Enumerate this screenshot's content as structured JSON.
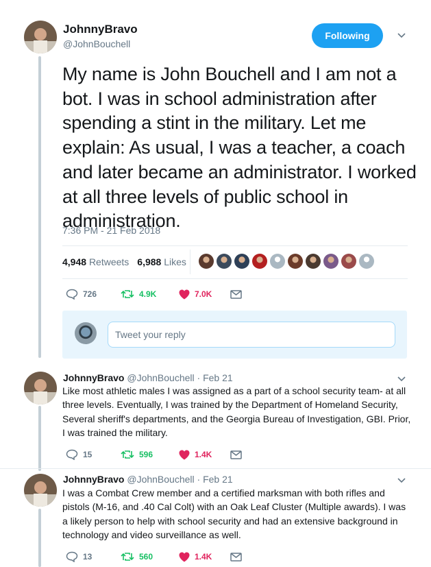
{
  "main_tweet": {
    "display_name": "JohnnyBravo",
    "handle": "@JohnBouchell",
    "follow_label": "Following",
    "text": "My name is John Bouchell and I am not a bot. I was in school administration after spending a stint in the military.  Let me explain: As usual, I was a teacher, a coach and later became an administrator. I worked at all three levels of public school in administration.",
    "timestamp": "7:36 PM - 21 Feb 2018",
    "retweets_count": "4,948",
    "retweets_label": "Retweets",
    "likes_count": "6,988",
    "likes_label": "Likes",
    "actions": {
      "replies": "726",
      "retweets": "4.9K",
      "likes": "7.0K"
    }
  },
  "likers": [
    {
      "icon": "liker-avatar",
      "color": "#5a3a2e"
    },
    {
      "icon": "liker-avatar",
      "color": "#3b4a5c"
    },
    {
      "icon": "liker-avatar",
      "color": "#2e4057"
    },
    {
      "icon": "liker-avatar",
      "color": "#b32020"
    },
    {
      "icon": "default-avatar",
      "color": "#aab8c2"
    },
    {
      "icon": "liker-avatar",
      "color": "#6b3b2a"
    },
    {
      "icon": "liker-avatar",
      "color": "#4a3a30"
    },
    {
      "icon": "liker-avatar",
      "color": "#7a5a8a"
    },
    {
      "icon": "liker-avatar",
      "color": "#9a4a4a"
    },
    {
      "icon": "default-avatar",
      "color": "#aab8c2"
    }
  ],
  "reply_box": {
    "placeholder": "Tweet your reply"
  },
  "replies": [
    {
      "display_name": "JohnnyBravo",
      "meta": "@JohnBouchell · Feb 21",
      "text": "Like most athletic males I was assigned as a part of a school security team- at all three levels. Eventually, I was trained by the Department of Homeland Security, Several sheriff's departments, and the Georgia Bureau of Investigation, GBI. Prior, I was trained the military.",
      "replies": "15",
      "retweets": "596",
      "likes": "1.4K"
    },
    {
      "display_name": "JohnnyBravo",
      "meta": "@JohnBouchell · Feb 21",
      "text": "I was a Combat Crew member and a certified marksman with both rifles and pistols (M-16, and .40 Cal Colt) with an Oak Leaf Cluster (Multiple awards). I was a likely person to help with school security and had an extensive background in technology and video surveillance as well.",
      "replies": "13",
      "retweets": "560",
      "likes": "1.4K"
    }
  ],
  "colors": {
    "accent": "#1da1f2",
    "retweet": "#17bf63",
    "like": "#e0245e",
    "muted": "#657786"
  }
}
